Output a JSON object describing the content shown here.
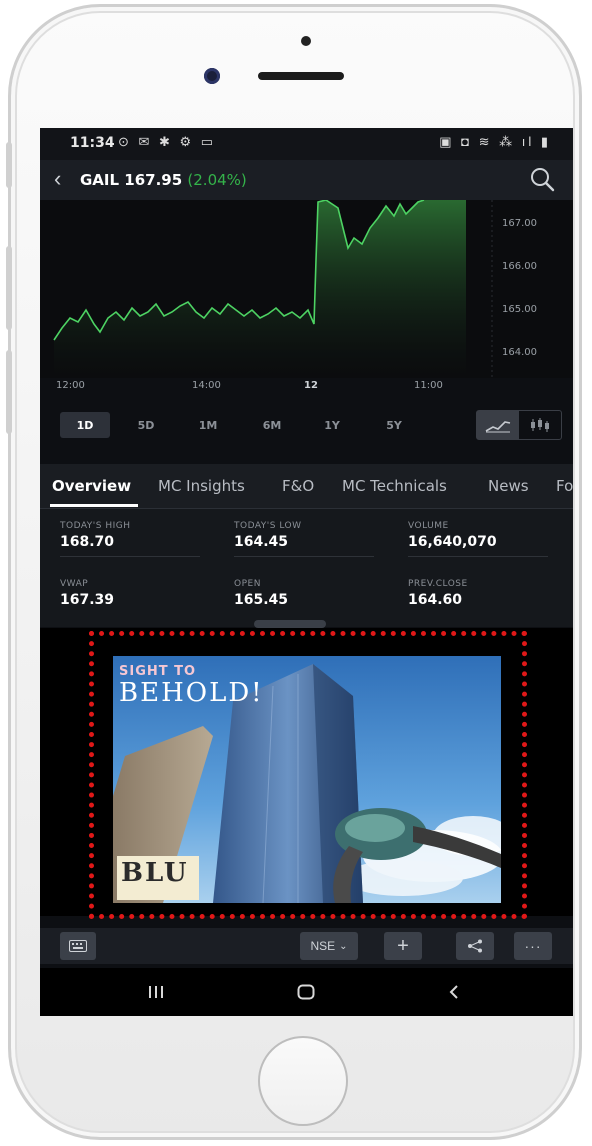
{
  "status_bar": {
    "time": "11:34",
    "left_icons": "⊙ ✉ ✱ ⚙ ▭",
    "right_icons": "▣ ◘ ≋ ⁂ ıl ▮"
  },
  "header": {
    "stock": "GAIL 167.95",
    "change": "(2.04%)"
  },
  "chart": {
    "y_ticks": [
      "167.00",
      "166.00",
      "165.00",
      "164.00"
    ],
    "x_ticks": [
      "12:00",
      "14:00",
      "12",
      "11:00"
    ]
  },
  "ranges": [
    "1D",
    "5D",
    "1M",
    "6M",
    "1Y",
    "5Y"
  ],
  "active_range": "1D",
  "tabs": [
    "Overview",
    "MC Insights",
    "F&O",
    "MC Technicals",
    "News",
    "Fo"
  ],
  "stats": [
    {
      "label": "TODAY'S HIGH",
      "value": "168.70"
    },
    {
      "label": "TODAY'S LOW",
      "value": "164.45"
    },
    {
      "label": "VOLUME",
      "value": "16,640,070"
    },
    {
      "label": "VWAP",
      "value": "167.39"
    },
    {
      "label": "OPEN",
      "value": "165.45"
    },
    {
      "label": "PREV.CLOSE",
      "value": "164.60"
    }
  ],
  "ad": {
    "line1": "SIGHT TO",
    "line2": "BEHOLD!",
    "logo": "BLU"
  },
  "toolbar": {
    "exchange": "NSE"
  },
  "colors": {
    "accent_green": "#34b34a",
    "highlight_red": "#e01818",
    "screen_bg": "#0d0f13"
  }
}
